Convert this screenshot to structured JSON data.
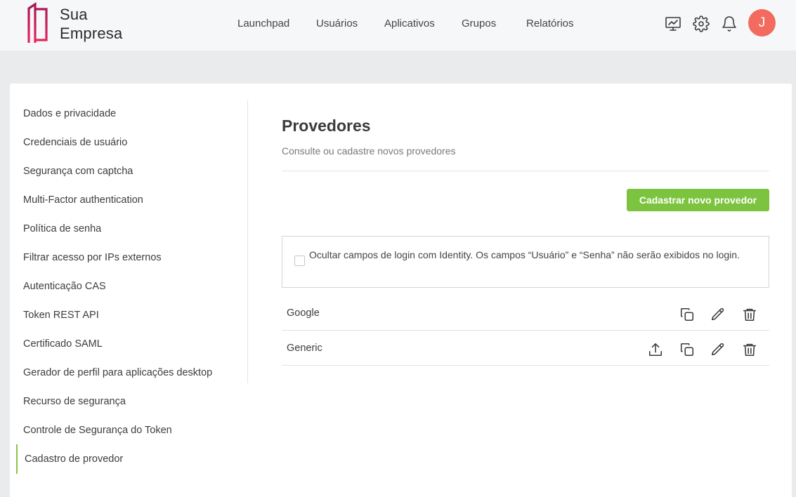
{
  "brand": {
    "line1": "Sua",
    "line2": "Empresa"
  },
  "nav": [
    "Launchpad",
    "Usuários",
    "Aplicativos",
    "Grupos",
    "Relatórios"
  ],
  "header_icons": [
    "monitor-chart-icon",
    "gear-icon",
    "bell-icon"
  ],
  "user": {
    "initial": "J",
    "avatar_color": "#f26b5e"
  },
  "sidebar": {
    "items": [
      {
        "label": "Dados e privacidade"
      },
      {
        "label": "Credenciais de usuário"
      },
      {
        "label": "Segurança com captcha"
      },
      {
        "label": "Multi-Factor authentication"
      },
      {
        "label": "Política de senha"
      },
      {
        "label": "Filtrar acesso por IPs externos"
      },
      {
        "label": "Autenticação CAS"
      },
      {
        "label": "Token REST API"
      },
      {
        "label": "Certificado SAML"
      },
      {
        "label": "Gerador de perfil para aplicações desktop"
      },
      {
        "label": "Recurso de segurança"
      },
      {
        "label": "Controle de Segurança do Token"
      },
      {
        "label": "Cadastro de provedor"
      }
    ],
    "active": "Cadastro de provedor",
    "active_color": "#8bc34a"
  },
  "main": {
    "title": "Provedores",
    "subtitle": "Consulte ou cadastre novos provedores",
    "add_button": "Cadastrar novo provedor",
    "accent_color": "#7cc43f",
    "hide_login_option": {
      "checked": false,
      "text": "Ocultar campos de login com Identity. Os campos “Usuário” e “Senha” não serão exibidos no login."
    },
    "providers": [
      {
        "name": "Google",
        "actions": [
          "copy-icon",
          "edit-icon",
          "trash-icon"
        ]
      },
      {
        "name": "Generic",
        "actions": [
          "upload-icon",
          "copy-icon",
          "edit-icon",
          "trash-icon"
        ]
      }
    ]
  }
}
